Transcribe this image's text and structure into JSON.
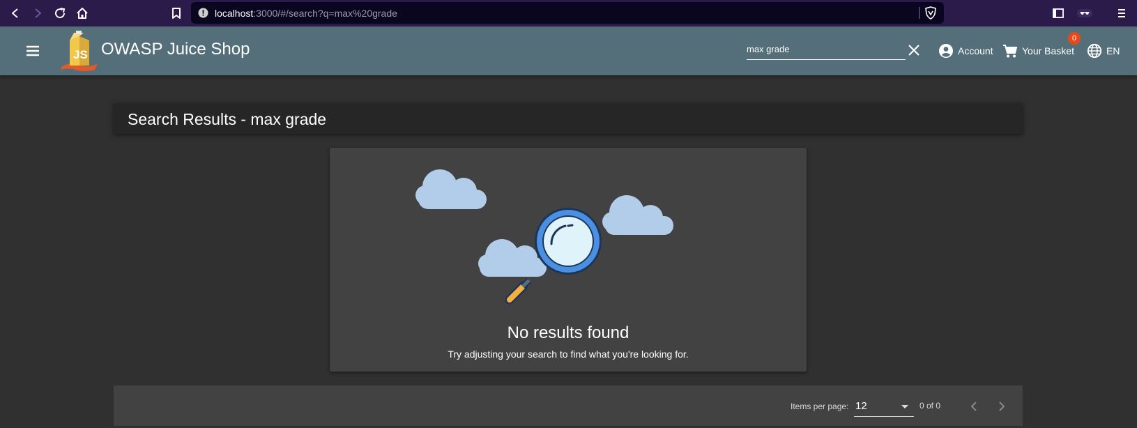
{
  "browser": {
    "url_host": "localhost",
    "url_rest": ":3000/#/search?q=max%20grade"
  },
  "app": {
    "title": "OWASP Juice Shop"
  },
  "search": {
    "value": "max grade"
  },
  "toolbar": {
    "account_label": "Account",
    "basket_label": "Your Basket",
    "basket_count": "0",
    "language_label": "EN"
  },
  "results": {
    "title": "Search Results - max grade"
  },
  "empty_state": {
    "title": "No results found",
    "subtitle": "Try adjusting your search to find what you're looking for."
  },
  "paginator": {
    "items_per_page_label": "Items per page:",
    "items_per_page_value": "12",
    "range_label": "0 of 0"
  },
  "colors": {
    "toolbar": "#546e7a",
    "background": "#303030",
    "card": "#424242",
    "badge": "#e64a19",
    "cloud": "#b1cdea",
    "lens_ring": "#4a90e2"
  }
}
